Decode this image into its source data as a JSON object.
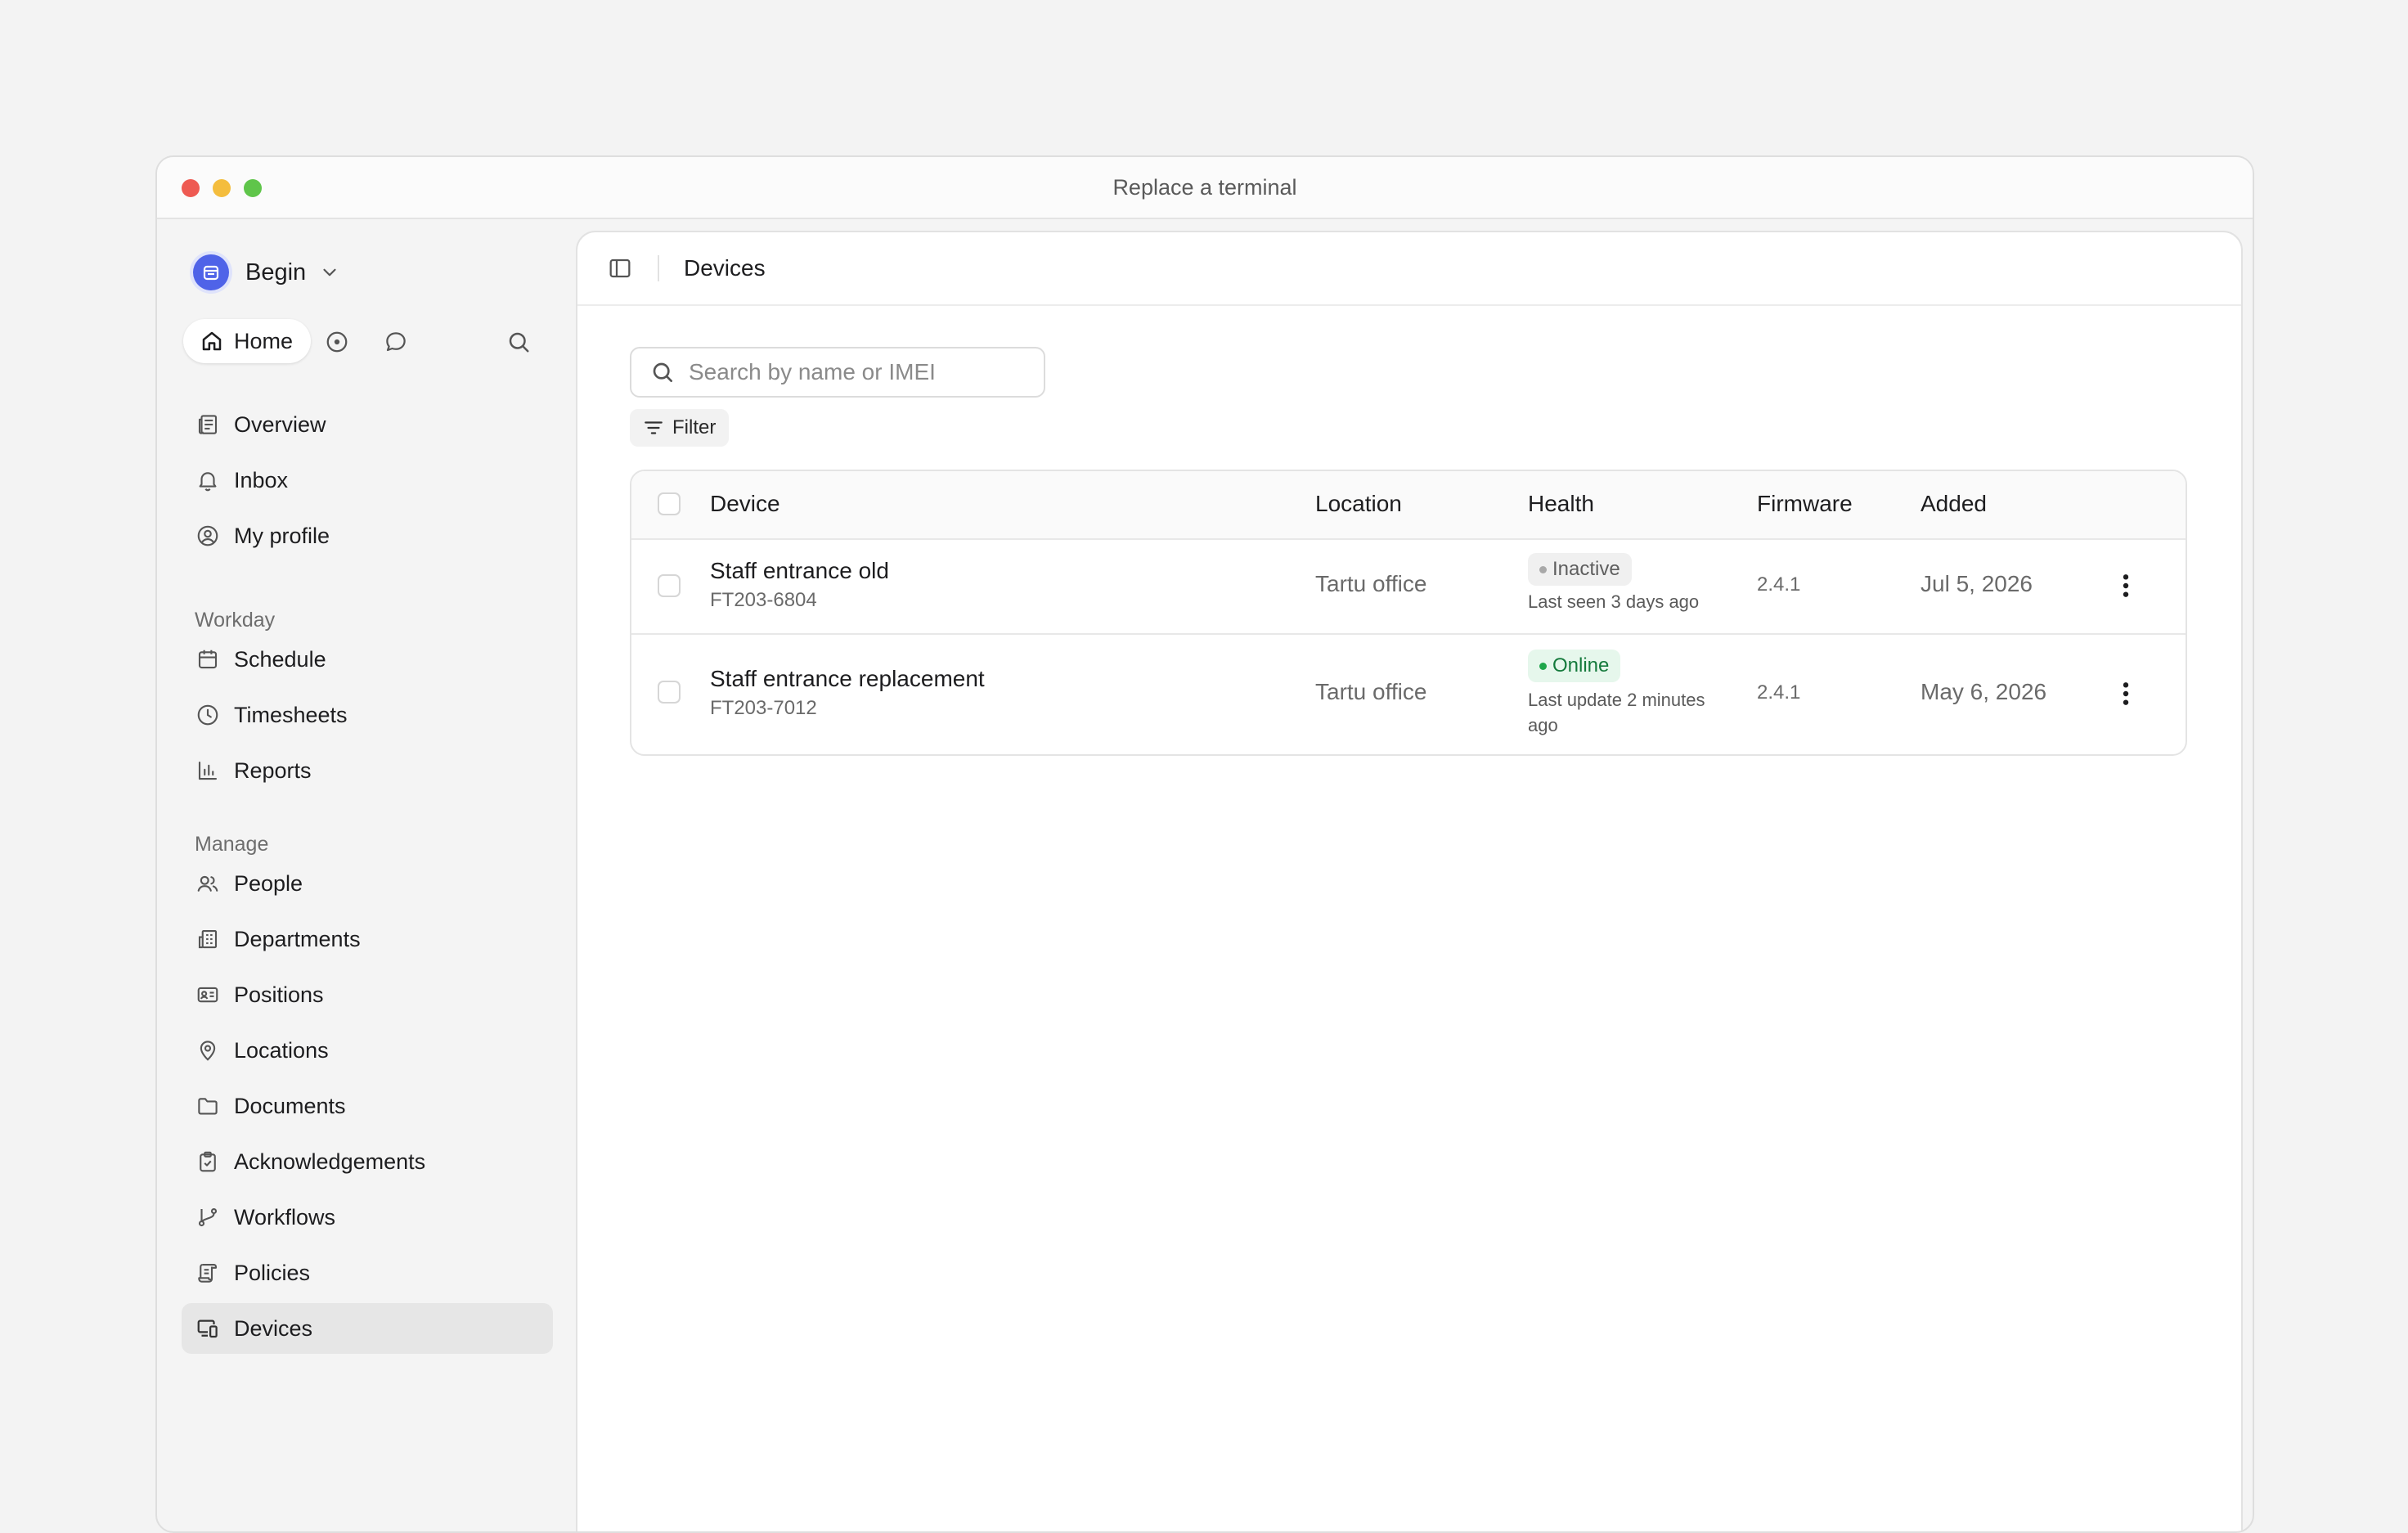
{
  "window": {
    "title": "Replace a terminal"
  },
  "workspace": {
    "name": "Begin"
  },
  "quickbar": {
    "home_label": "Home"
  },
  "nav_primary": [
    {
      "label": "Overview",
      "icon": "newspaper-icon"
    },
    {
      "label": "Inbox",
      "icon": "bell-icon"
    },
    {
      "label": "My profile",
      "icon": "user-circle-icon"
    }
  ],
  "sections": {
    "workday": "Workday",
    "manage": "Manage"
  },
  "nav_workday": [
    {
      "label": "Schedule",
      "icon": "calendar-icon"
    },
    {
      "label": "Timesheets",
      "icon": "clock-icon"
    },
    {
      "label": "Reports",
      "icon": "bar-chart-icon"
    }
  ],
  "nav_manage": [
    {
      "label": "People",
      "icon": "users-icon"
    },
    {
      "label": "Departments",
      "icon": "building-icon"
    },
    {
      "label": "Positions",
      "icon": "id-card-icon"
    },
    {
      "label": "Locations",
      "icon": "map-pin-icon"
    },
    {
      "label": "Documents",
      "icon": "folder-icon"
    },
    {
      "label": "Acknowledgements",
      "icon": "clipboard-check-icon"
    },
    {
      "label": "Workflows",
      "icon": "git-branch-icon"
    },
    {
      "label": "Policies",
      "icon": "scroll-icon"
    },
    {
      "label": "Devices",
      "icon": "devices-icon",
      "active": true
    }
  ],
  "main": {
    "title": "Devices",
    "search_placeholder": "Search by name or IMEI",
    "filter_label": "Filter",
    "columns": {
      "device": "Device",
      "location": "Location",
      "health": "Health",
      "firmware": "Firmware",
      "added": "Added"
    },
    "rows": [
      {
        "name": "Staff entrance old",
        "imei": "FT203-6804",
        "location": "Tartu office",
        "status": "Inactive",
        "health_note": "Last seen 3 days ago",
        "firmware": "2.4.1",
        "added": "Jul 5, 2026"
      },
      {
        "name": "Staff entrance replacement",
        "imei": "FT203-7012",
        "location": "Tartu office",
        "status": "Online",
        "health_note": "Last update 2 minutes ago",
        "firmware": "2.4.1",
        "added": "May 6, 2026"
      }
    ]
  },
  "colors": {
    "accent": "#4f63e8",
    "online": "#1ea64a",
    "inactive": "#a8a8a8",
    "active_nav_bg": "#e6e6e6"
  }
}
